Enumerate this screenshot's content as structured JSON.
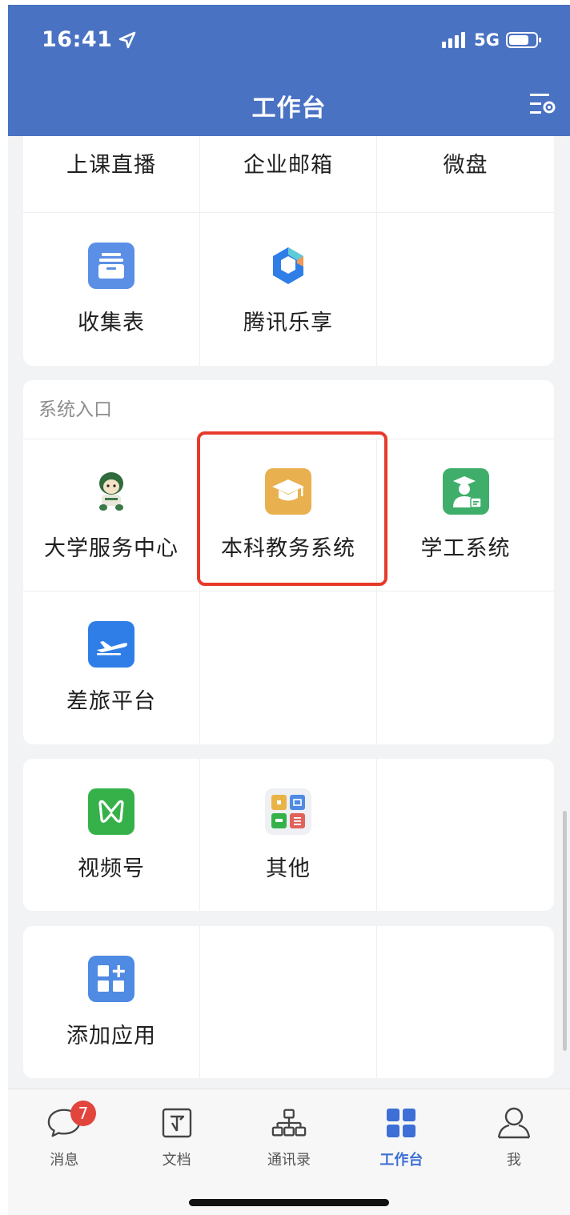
{
  "status_bar": {
    "time": "16:41",
    "network": "5G"
  },
  "header": {
    "title": "工作台",
    "settings_icon": "list-settings-icon"
  },
  "sections": {
    "apps_top": {
      "row1": [
        "上课直播",
        "企业邮箱",
        "微盘"
      ],
      "row2": [
        {
          "label": "收集表",
          "icon": "collect-form-icon",
          "color": "#5b8fe6"
        },
        {
          "label": "腾讯乐享",
          "icon": "tencent-lexiang-icon",
          "color": "#2f7ee8"
        }
      ]
    },
    "system_entry": {
      "title": "系统入口",
      "items": [
        {
          "label": "大学服务中心",
          "icon": "mascot-icon",
          "color": "#3a7a4a"
        },
        {
          "label": "本科教务系统",
          "icon": "graduation-cap-icon",
          "color": "#e8b04f"
        },
        {
          "label": "学工系统",
          "icon": "student-certificate-icon",
          "color": "#3fae6a"
        },
        {
          "label": "差旅平台",
          "icon": "airplane-icon",
          "color": "#2f7ee8"
        }
      ]
    },
    "media": {
      "items": [
        {
          "label": "视频号",
          "icon": "channels-icon",
          "color": "#36b14a"
        },
        {
          "label": "其他",
          "icon": "other-apps-grid-icon",
          "color": "#e9b346"
        }
      ]
    },
    "add": {
      "items": [
        {
          "label": "添加应用",
          "icon": "add-app-icon",
          "color": "#4f8ae3"
        }
      ]
    }
  },
  "tabbar": {
    "items": [
      {
        "label": "消息",
        "icon": "chat-bubble-icon",
        "badge": "7"
      },
      {
        "label": "文档",
        "icon": "document-icon"
      },
      {
        "label": "通讯录",
        "icon": "org-chart-icon"
      },
      {
        "label": "工作台",
        "icon": "workbench-grid-icon",
        "active": true
      },
      {
        "label": "我",
        "icon": "person-icon"
      }
    ]
  },
  "colors": {
    "header_bg": "#4a72c3",
    "active_tab": "#3d6fd6",
    "highlight": "#e73a2b",
    "badge": "#e2453c"
  }
}
